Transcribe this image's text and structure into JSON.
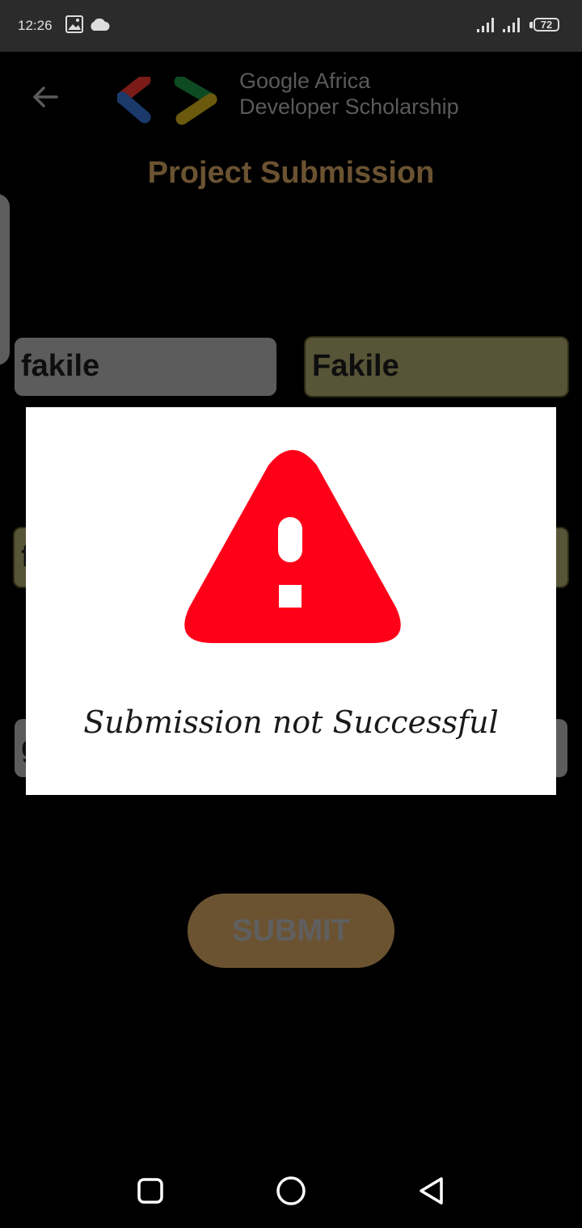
{
  "status": {
    "time": "12:26",
    "battery": "72"
  },
  "header": {
    "brand_line1": "Google Africa",
    "brand_line2": "Developer Scholarship",
    "title": "Project Submission"
  },
  "form": {
    "first_name": "fakile",
    "last_name": "Fakile",
    "email_partial": "f",
    "link_partial": "g",
    "submit_label": "SUBMIT"
  },
  "dialog": {
    "message": "Submission not Successful",
    "icon": "warning-triangle-icon"
  },
  "colors": {
    "accent": "#6b5332",
    "warning": "#ff0019"
  },
  "nav": {
    "recents": "recents-icon",
    "home": "home-icon",
    "back": "back-icon"
  }
}
